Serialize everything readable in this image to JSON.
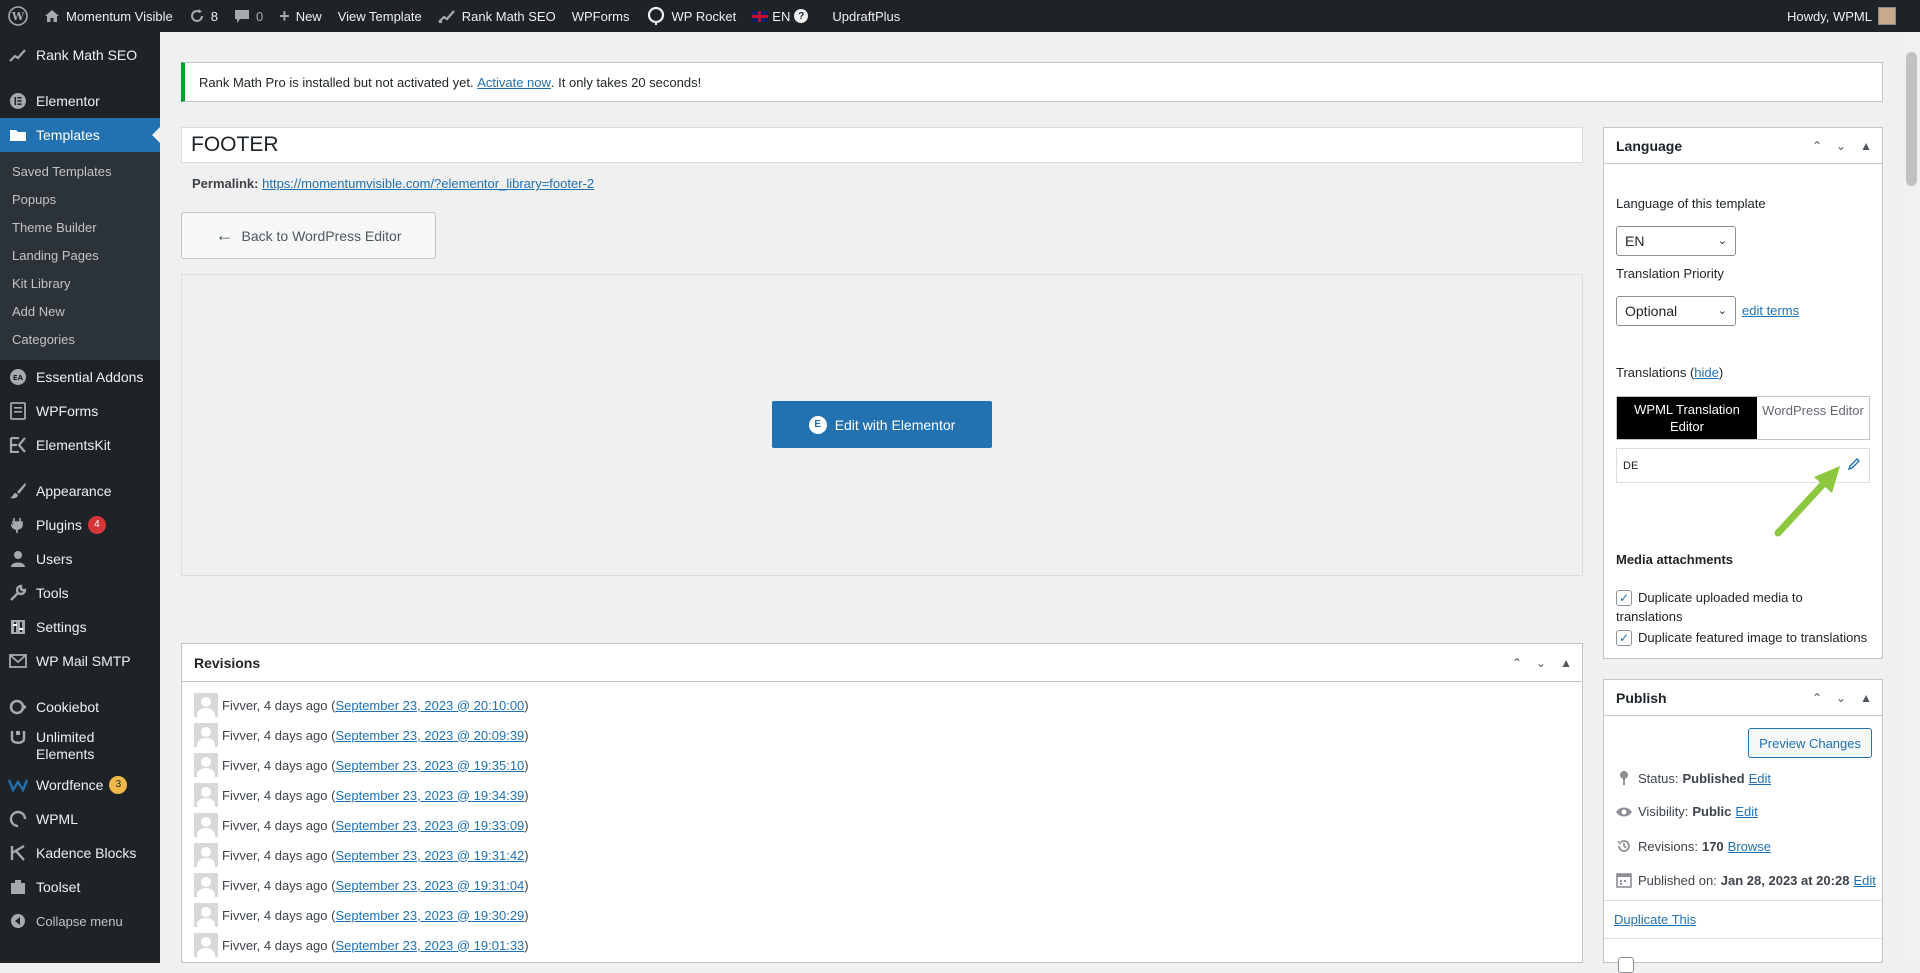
{
  "adminbar": {
    "site_name": "Momentum Visible",
    "updates_count": "8",
    "comments_count": "0",
    "new_label": "New",
    "view_template": "View Template",
    "rank_math": "Rank Math SEO",
    "wpforms": "WPForms",
    "wp_rocket": "WP Rocket",
    "language": "EN",
    "updraft": "UpdraftPlus",
    "howdy": "Howdy, WPML"
  },
  "sidebar": {
    "rank_math": "Rank Math SEO",
    "elementor": "Elementor",
    "templates": "Templates",
    "sub": [
      "Saved Templates",
      "Popups",
      "Theme Builder",
      "Landing Pages",
      "Kit Library",
      "Add New",
      "Categories"
    ],
    "essential_addons": "Essential Addons",
    "wpforms": "WPForms",
    "elementskit": "ElementsKit",
    "appearance": "Appearance",
    "plugins": "Plugins",
    "plugins_badge": "4",
    "users": "Users",
    "tools": "Tools",
    "settings": "Settings",
    "wp_mail_smtp": "WP Mail SMTP",
    "cookiebot": "Cookiebot",
    "unlimited_elements_1": "Unlimited",
    "unlimited_elements_2": "Elements",
    "wordfence": "Wordfence",
    "wordfence_badge": "3",
    "wpml": "WPML",
    "kadence": "Kadence Blocks",
    "toolset": "Toolset",
    "collapse": "Collapse menu"
  },
  "notice": {
    "text_before": "Rank Math Pro is installed but not activated yet. ",
    "link": "Activate now",
    "text_after": ". It only takes 20 seconds!"
  },
  "editor": {
    "title": "FOOTER",
    "permalink_label": "Permalink:",
    "permalink_url": "https://momentumvisible.com/?elementor_library=footer-2",
    "back_button": "Back to WordPress Editor",
    "edit_elementor": "Edit with Elementor"
  },
  "revisions": {
    "heading": "Revisions",
    "rows": [
      {
        "prefix": "Fivver, 4 days ago (",
        "date": "September 23, 2023 @ 20:10:00",
        "suffix": ")"
      },
      {
        "prefix": "Fivver, 4 days ago (",
        "date": "September 23, 2023 @ 20:09:39",
        "suffix": ")"
      },
      {
        "prefix": "Fivver, 4 days ago (",
        "date": "September 23, 2023 @ 19:35:10",
        "suffix": ")"
      },
      {
        "prefix": "Fivver, 4 days ago (",
        "date": "September 23, 2023 @ 19:34:39",
        "suffix": ")"
      },
      {
        "prefix": "Fivver, 4 days ago (",
        "date": "September 23, 2023 @ 19:33:09",
        "suffix": ")"
      },
      {
        "prefix": "Fivver, 4 days ago (",
        "date": "September 23, 2023 @ 19:31:42",
        "suffix": ")"
      },
      {
        "prefix": "Fivver, 4 days ago (",
        "date": "September 23, 2023 @ 19:31:04",
        "suffix": ")"
      },
      {
        "prefix": "Fivver, 4 days ago (",
        "date": "September 23, 2023 @ 19:30:29",
        "suffix": ")"
      },
      {
        "prefix": "Fivver, 4 days ago (",
        "date": "September 23, 2023 @ 19:01:33",
        "suffix": ")"
      }
    ]
  },
  "language_box": {
    "heading": "Language",
    "lang_label": "Language of this template",
    "lang_value": "EN",
    "priority_label": "Translation Priority",
    "priority_value": "Optional",
    "edit_terms": "edit terms",
    "translations_label": "Translations (",
    "hide": "hide",
    "translations_close": ")",
    "toggle_on_1": "WPML Translation",
    "toggle_on_2": "Editor",
    "toggle_off": "WordPress Editor",
    "de_label": "DE",
    "media_label": "Media attachments",
    "dup_media_1": "Duplicate uploaded media to",
    "dup_media_2": "translations",
    "dup_featured": "Duplicate featured image to translations"
  },
  "publish_box": {
    "heading": "Publish",
    "preview": "Preview Changes",
    "status_label": "Status:",
    "status_value": "Published",
    "visibility_label": "Visibility:",
    "visibility_value": "Public",
    "revisions_label": "Revisions:",
    "revisions_value": "170",
    "browse": "Browse",
    "published_label": "Published on:",
    "published_value": "Jan 28, 2023 at 20:28",
    "edit": "Edit",
    "duplicate": "Duplicate This"
  },
  "colors": {
    "admin_dark": "#1d2327",
    "accent_blue": "#2271b1",
    "notice_green": "#00a32a",
    "arrow_green": "#8dc63f"
  }
}
